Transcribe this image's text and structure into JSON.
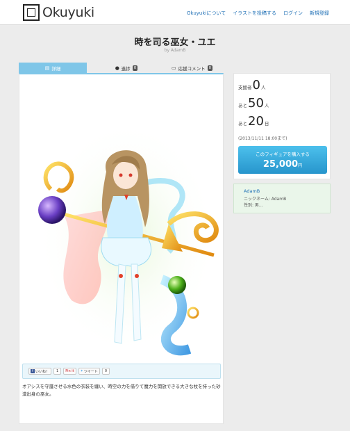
{
  "header": {
    "logo_text": "Okuyuki",
    "nav": [
      "Okuyukiについて",
      "イラストを投稿する",
      "ログイン",
      "新規登録"
    ]
  },
  "page": {
    "title": "時を司る巫女・ユエ",
    "byline": "by AdamB"
  },
  "tabs": [
    {
      "icon": "document-icon",
      "label": "詳細",
      "badge": ""
    },
    {
      "icon": "check-circle-icon",
      "label": "進捗",
      "badge": "0"
    },
    {
      "icon": "speech-bubble-icon",
      "label": "応援コメント",
      "badge": "0"
    }
  ],
  "share": {
    "facebook_label": "いいね！",
    "facebook_count": "1",
    "pinterest_label": "Pin it",
    "tweet_label": "ツイート",
    "tweet_count": "0"
  },
  "description": "オアシスを守護させる水色の衣装を纏い、時空の力を借りて魔力を開放できる大きな杖を持った砂漠出身の巫女。",
  "support": {
    "supporters_prefix": "支援者",
    "supporters_value": "0",
    "supporters_unit": "人",
    "remaining_prefix": "あと",
    "remaining_people": "50",
    "remaining_people_unit": "人",
    "remaining_days_prefix": "あと",
    "remaining_days": "20",
    "remaining_days_unit": "日",
    "deadline": "(2013/11/11 18:00まで)",
    "buy_label": "このフィギュアを購入する",
    "price": "25,000",
    "price_unit": "円"
  },
  "owner": {
    "name": "AdamB",
    "nickname_line": "ニックネーム: AdamB",
    "gender_line": "性別: 男..."
  },
  "colors": {
    "accent": "#7fc6e8",
    "buy_button": "#2f9fd6",
    "link": "#1e6fb5",
    "owner_panel_bg": "#eaf6ea"
  }
}
